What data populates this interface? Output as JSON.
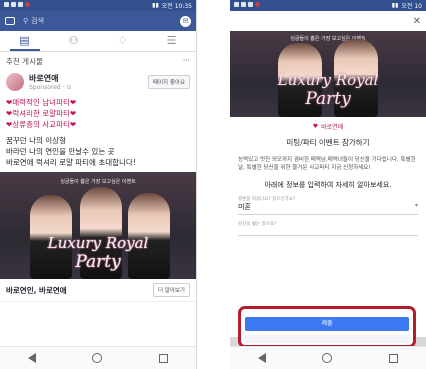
{
  "status_left": {
    "time": "오전 10:35"
  },
  "status_right": {
    "time": "오전 10"
  },
  "left": {
    "search_placeholder": "검색",
    "section_title": "추천 게시물",
    "section_more": "···",
    "page_name": "바로연애",
    "sponsored": "Sponsored · ⊙",
    "like_button": "페이지 좋아요",
    "body_lines": [
      "❤매력적인 남녀파티❤",
      "❤럭셔리한 로얄파티❤",
      "❤상류층의 사교파티❤",
      "",
      "꿈꾸던 나의 이상형",
      "바라던 나의 연인을 만날수 있는 곳",
      "바로연애 럭셔리 로얄 파티에 초대합니다!"
    ],
    "hero_tagline": "싱글들이 뽑은 가장 보고싶은 이벤트",
    "hero_word1": "Luxury Royal",
    "hero_word2": "Party",
    "footer_text": "바로연인, 바로연애",
    "footer_button": "더 알아보기"
  },
  "right": {
    "close": "✕",
    "hero_tagline": "싱글들이 뽑은 가장 보고싶은 이벤트",
    "hero_word1": "Luxury Royal",
    "hero_word2": "Party",
    "brand": "바로연애",
    "title": "미팅/파티 이벤트 참가하기",
    "description": "능력있고 멋진 외모까지 겸비한 매력남,매력녀들이 당신을 기다립니다, 특별한날, 특별한 당신을 위한 즐거운 사교파티 지금 신청하세요!",
    "subtitle": "아래에 정보를 입력하여 자세히 알아보세요.",
    "field1_label": "결혼을 하셨나요? 있으신가요?",
    "field1_value": "미혼",
    "field2_label": "당신의 혈는 알으요?",
    "submit": "제출"
  },
  "colors": {
    "fb_blue": "#3b5998",
    "highlight": "#b11c2e",
    "submit": "#3b78f2"
  }
}
